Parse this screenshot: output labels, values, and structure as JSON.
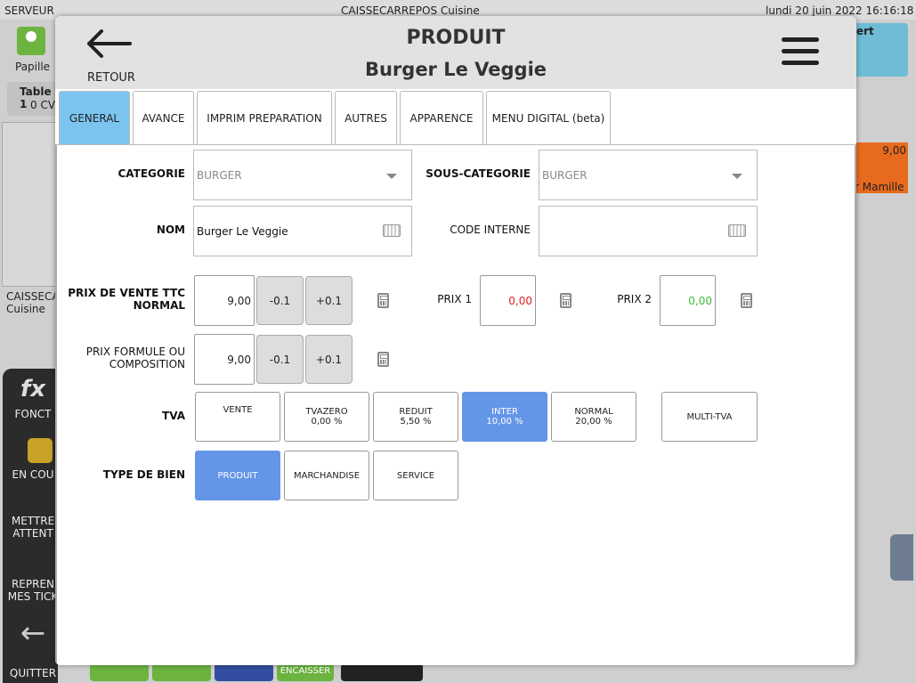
{
  "topbar": {
    "role": "SERVEUR",
    "station": "CAISSECARREPOS  Cuisine",
    "datetime": "lundi 20 juin 2022   16:16:18"
  },
  "background": {
    "user": "Papille",
    "table_label": "Table 1",
    "covers": "0 CV",
    "caisse_line1": "CAISSECA",
    "caisse_line2": "Cuisine",
    "menu": [
      {
        "label1": "FONCT",
        "label2": ""
      },
      {
        "label1": "EN COU",
        "label2": ""
      },
      {
        "label1": "METTRE",
        "label2": "ATTENT"
      },
      {
        "label1": "REPREN",
        "label2": "MES TICK"
      },
      {
        "label1": "QUITTER",
        "label2": ""
      }
    ],
    "right_label": "ert",
    "right_price": "9,00",
    "right_name": "r Mamille",
    "bottom_encaisser": "ENCAISSER"
  },
  "modal": {
    "back_label": "RETOUR",
    "title": "PRODUIT",
    "subtitle": "Burger Le Veggie",
    "tabs": [
      "GENERAL",
      "AVANCE",
      "IMPRIM PREPARATION",
      "AUTRES",
      "APPARENCE",
      "MENU DIGITAL (beta)"
    ],
    "active_tab": "GENERAL"
  },
  "form": {
    "categorie_label": "CATEGORIE",
    "categorie_value": "BURGER",
    "souscat_label": "SOUS-CATEGORIE",
    "souscat_value": "BURGER",
    "nom_label": "NOM",
    "nom_value": "Burger Le Veggie",
    "code_label": "CODE INTERNE",
    "code_value": "",
    "prix_label1": "PRIX DE VENTE TTC",
    "prix_label2": "NORMAL",
    "prix_value": "9,00",
    "minus": "-0.1",
    "plus": "+0.1",
    "prix1_label": "PRIX 1",
    "prix1_value": "0,00",
    "prix1_color": "#e02020",
    "prix2_label": "PRIX 2",
    "prix2_value": "0,00",
    "prix2_color": "#3cbf3c",
    "formule_label1": "PRIX FORMULE OU",
    "formule_label2": "COMPOSITION",
    "formule_value": "9,00",
    "tva_label": "TVA",
    "tva_options": [
      {
        "name": "VENTE",
        "rate": ""
      },
      {
        "name": "TVAZERO",
        "rate": "0,00 %"
      },
      {
        "name": "REDUIT",
        "rate": "5,50 %"
      },
      {
        "name": "INTER",
        "rate": "10,00 %"
      },
      {
        "name": "NORMAL",
        "rate": "20,00 %"
      }
    ],
    "tva_selected": "INTER",
    "multi_tva": "MULTI-TVA",
    "type_label": "TYPE DE BIEN",
    "type_options": [
      "PRODUIT",
      "MARCHANDISE",
      "SERVICE"
    ],
    "type_selected": "PRODUIT",
    "accent": "#6496e8"
  }
}
